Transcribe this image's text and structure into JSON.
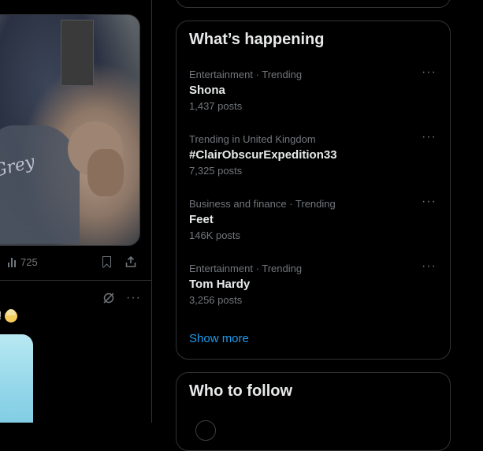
{
  "feed": {
    "post1": {
      "views": "725",
      "media_signature": "Grey"
    },
    "post2": {
      "text": "!"
    }
  },
  "trends": {
    "title": "What’s happening",
    "items": [
      {
        "meta": "Entertainment · Trending",
        "name": "Shona",
        "count": "1,437 posts"
      },
      {
        "meta": "Trending in United Kingdom",
        "name": "#ClairObscurExpedition33",
        "count": "7,325 posts"
      },
      {
        "meta": "Business and finance · Trending",
        "name": "Feet",
        "count": "146K posts"
      },
      {
        "meta": "Entertainment · Trending",
        "name": "Tom Hardy",
        "count": "3,256 posts"
      }
    ],
    "more_icon": "···",
    "show_more": "Show more"
  },
  "who_to_follow": {
    "title": "Who to follow"
  },
  "colors": {
    "background": "#000000",
    "border": "#2f3336",
    "text": "#e7e9ea",
    "muted": "#71767b",
    "accent": "#1d9bf0"
  },
  "icons": [
    "analytics-icon",
    "bookmark-icon",
    "share-icon",
    "hide-icon",
    "more-icon",
    "emoji-icon"
  ]
}
